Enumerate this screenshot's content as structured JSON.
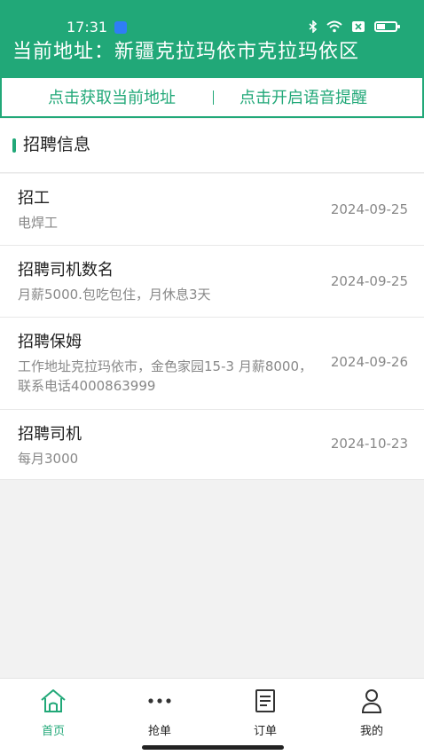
{
  "status_bar": {
    "time": "17:31"
  },
  "header": {
    "title": "当前地址：新疆克拉玛依市克拉玛依区"
  },
  "actions": {
    "get_location": "点击获取当前地址",
    "separator": "|",
    "voice_alert": "点击开启语音提醒"
  },
  "section": {
    "title": "招聘信息"
  },
  "jobs": [
    {
      "title": "招工",
      "desc": "电焊工",
      "date": "2024-09-25"
    },
    {
      "title": "招聘司机数名",
      "desc": "月薪5000.包吃包住，月休息3天",
      "date": "2024-09-25"
    },
    {
      "title": "招聘保姆",
      "desc": "工作地址克拉玛依市，金色家园15-3 月薪8000，联系电话4000863999",
      "date": "2024-09-26"
    },
    {
      "title": "招聘司机",
      "desc": "每月3000",
      "date": "2024-10-23"
    }
  ],
  "tabbar": {
    "items": [
      {
        "label": "首页",
        "icon": "home-icon",
        "active": true
      },
      {
        "label": "抢单",
        "icon": "more-dots-icon",
        "active": false
      },
      {
        "label": "订单",
        "icon": "document-icon",
        "active": false
      },
      {
        "label": "我的",
        "icon": "user-icon",
        "active": false
      }
    ]
  },
  "colors": {
    "brand": "#21a878",
    "text": "#222222",
    "muted": "#888888",
    "background": "#f2f2f2"
  }
}
